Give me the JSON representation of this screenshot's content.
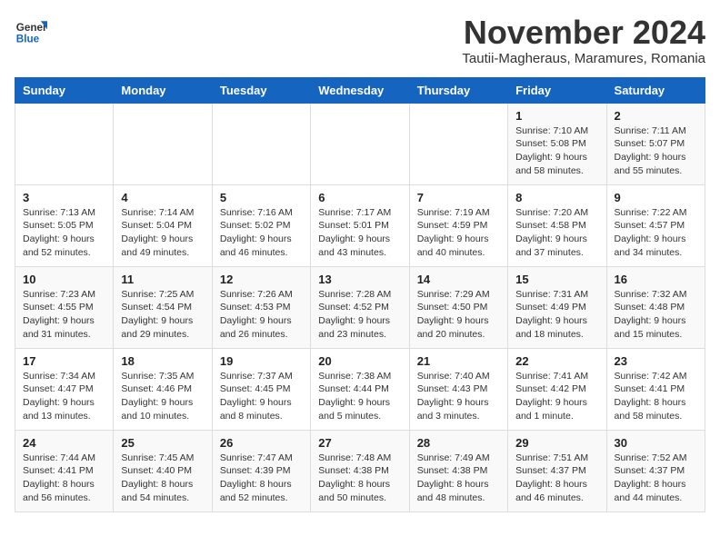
{
  "logo": {
    "general": "General",
    "blue": "Blue"
  },
  "header": {
    "month": "November 2024",
    "location": "Tautii-Magheraus, Maramures, Romania"
  },
  "days_of_week": [
    "Sunday",
    "Monday",
    "Tuesday",
    "Wednesday",
    "Thursday",
    "Friday",
    "Saturday"
  ],
  "weeks": [
    [
      {
        "day": "",
        "info": ""
      },
      {
        "day": "",
        "info": ""
      },
      {
        "day": "",
        "info": ""
      },
      {
        "day": "",
        "info": ""
      },
      {
        "day": "",
        "info": ""
      },
      {
        "day": "1",
        "info": "Sunrise: 7:10 AM\nSunset: 5:08 PM\nDaylight: 9 hours and 58 minutes."
      },
      {
        "day": "2",
        "info": "Sunrise: 7:11 AM\nSunset: 5:07 PM\nDaylight: 9 hours and 55 minutes."
      }
    ],
    [
      {
        "day": "3",
        "info": "Sunrise: 7:13 AM\nSunset: 5:05 PM\nDaylight: 9 hours and 52 minutes."
      },
      {
        "day": "4",
        "info": "Sunrise: 7:14 AM\nSunset: 5:04 PM\nDaylight: 9 hours and 49 minutes."
      },
      {
        "day": "5",
        "info": "Sunrise: 7:16 AM\nSunset: 5:02 PM\nDaylight: 9 hours and 46 minutes."
      },
      {
        "day": "6",
        "info": "Sunrise: 7:17 AM\nSunset: 5:01 PM\nDaylight: 9 hours and 43 minutes."
      },
      {
        "day": "7",
        "info": "Sunrise: 7:19 AM\nSunset: 4:59 PM\nDaylight: 9 hours and 40 minutes."
      },
      {
        "day": "8",
        "info": "Sunrise: 7:20 AM\nSunset: 4:58 PM\nDaylight: 9 hours and 37 minutes."
      },
      {
        "day": "9",
        "info": "Sunrise: 7:22 AM\nSunset: 4:57 PM\nDaylight: 9 hours and 34 minutes."
      }
    ],
    [
      {
        "day": "10",
        "info": "Sunrise: 7:23 AM\nSunset: 4:55 PM\nDaylight: 9 hours and 31 minutes."
      },
      {
        "day": "11",
        "info": "Sunrise: 7:25 AM\nSunset: 4:54 PM\nDaylight: 9 hours and 29 minutes."
      },
      {
        "day": "12",
        "info": "Sunrise: 7:26 AM\nSunset: 4:53 PM\nDaylight: 9 hours and 26 minutes."
      },
      {
        "day": "13",
        "info": "Sunrise: 7:28 AM\nSunset: 4:52 PM\nDaylight: 9 hours and 23 minutes."
      },
      {
        "day": "14",
        "info": "Sunrise: 7:29 AM\nSunset: 4:50 PM\nDaylight: 9 hours and 20 minutes."
      },
      {
        "day": "15",
        "info": "Sunrise: 7:31 AM\nSunset: 4:49 PM\nDaylight: 9 hours and 18 minutes."
      },
      {
        "day": "16",
        "info": "Sunrise: 7:32 AM\nSunset: 4:48 PM\nDaylight: 9 hours and 15 minutes."
      }
    ],
    [
      {
        "day": "17",
        "info": "Sunrise: 7:34 AM\nSunset: 4:47 PM\nDaylight: 9 hours and 13 minutes."
      },
      {
        "day": "18",
        "info": "Sunrise: 7:35 AM\nSunset: 4:46 PM\nDaylight: 9 hours and 10 minutes."
      },
      {
        "day": "19",
        "info": "Sunrise: 7:37 AM\nSunset: 4:45 PM\nDaylight: 9 hours and 8 minutes."
      },
      {
        "day": "20",
        "info": "Sunrise: 7:38 AM\nSunset: 4:44 PM\nDaylight: 9 hours and 5 minutes."
      },
      {
        "day": "21",
        "info": "Sunrise: 7:40 AM\nSunset: 4:43 PM\nDaylight: 9 hours and 3 minutes."
      },
      {
        "day": "22",
        "info": "Sunrise: 7:41 AM\nSunset: 4:42 PM\nDaylight: 9 hours and 1 minute."
      },
      {
        "day": "23",
        "info": "Sunrise: 7:42 AM\nSunset: 4:41 PM\nDaylight: 8 hours and 58 minutes."
      }
    ],
    [
      {
        "day": "24",
        "info": "Sunrise: 7:44 AM\nSunset: 4:41 PM\nDaylight: 8 hours and 56 minutes."
      },
      {
        "day": "25",
        "info": "Sunrise: 7:45 AM\nSunset: 4:40 PM\nDaylight: 8 hours and 54 minutes."
      },
      {
        "day": "26",
        "info": "Sunrise: 7:47 AM\nSunset: 4:39 PM\nDaylight: 8 hours and 52 minutes."
      },
      {
        "day": "27",
        "info": "Sunrise: 7:48 AM\nSunset: 4:38 PM\nDaylight: 8 hours and 50 minutes."
      },
      {
        "day": "28",
        "info": "Sunrise: 7:49 AM\nSunset: 4:38 PM\nDaylight: 8 hours and 48 minutes."
      },
      {
        "day": "29",
        "info": "Sunrise: 7:51 AM\nSunset: 4:37 PM\nDaylight: 8 hours and 46 minutes."
      },
      {
        "day": "30",
        "info": "Sunrise: 7:52 AM\nSunset: 4:37 PM\nDaylight: 8 hours and 44 minutes."
      }
    ]
  ]
}
